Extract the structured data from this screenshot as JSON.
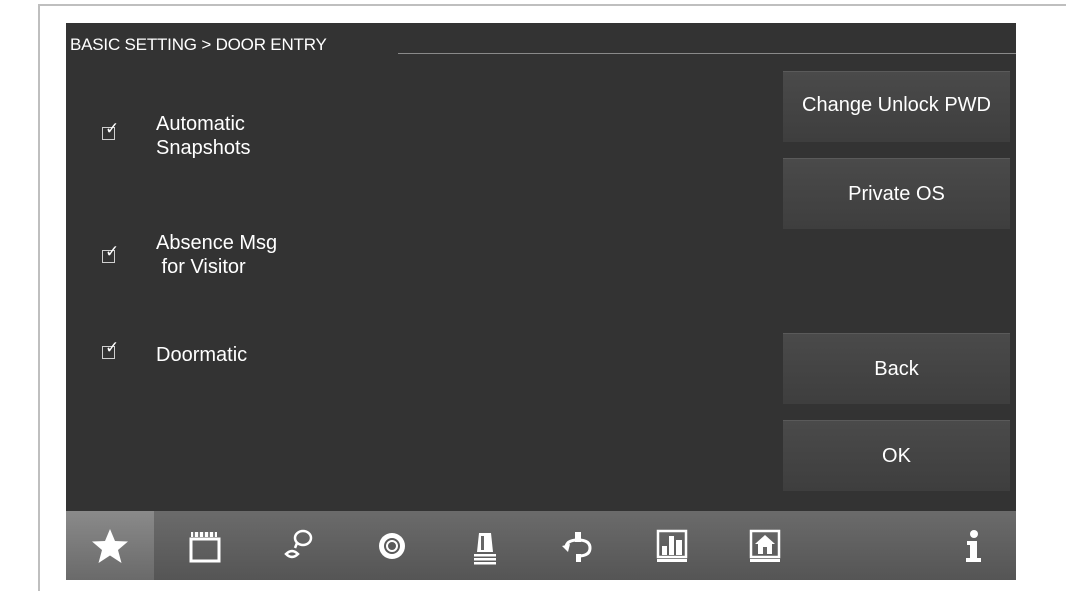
{
  "header": {
    "breadcrumb": "BASIC SETTING > DOOR ENTRY"
  },
  "options": [
    {
      "label": "Automatic\nSnapshots",
      "checked": true
    },
    {
      "label": "Absence Msg\n for Visitor",
      "checked": true
    },
    {
      "label": "Doormatic",
      "checked": true
    }
  ],
  "buttons": {
    "change_unlock_pwd": "Change Unlock PWD",
    "private_os": "Private OS",
    "back": "Back",
    "ok": "OK"
  },
  "nav": {
    "items": [
      {
        "icon": "star-icon",
        "active": true
      },
      {
        "icon": "clapperboard-icon"
      },
      {
        "icon": "intercom-speech-icon"
      },
      {
        "icon": "camera-lens-icon"
      },
      {
        "icon": "alarm-siren-icon"
      },
      {
        "icon": "satellite-rotate-icon"
      },
      {
        "icon": "building-control-icon"
      },
      {
        "icon": "home-icon"
      },
      {
        "icon": "info-icon"
      }
    ]
  }
}
